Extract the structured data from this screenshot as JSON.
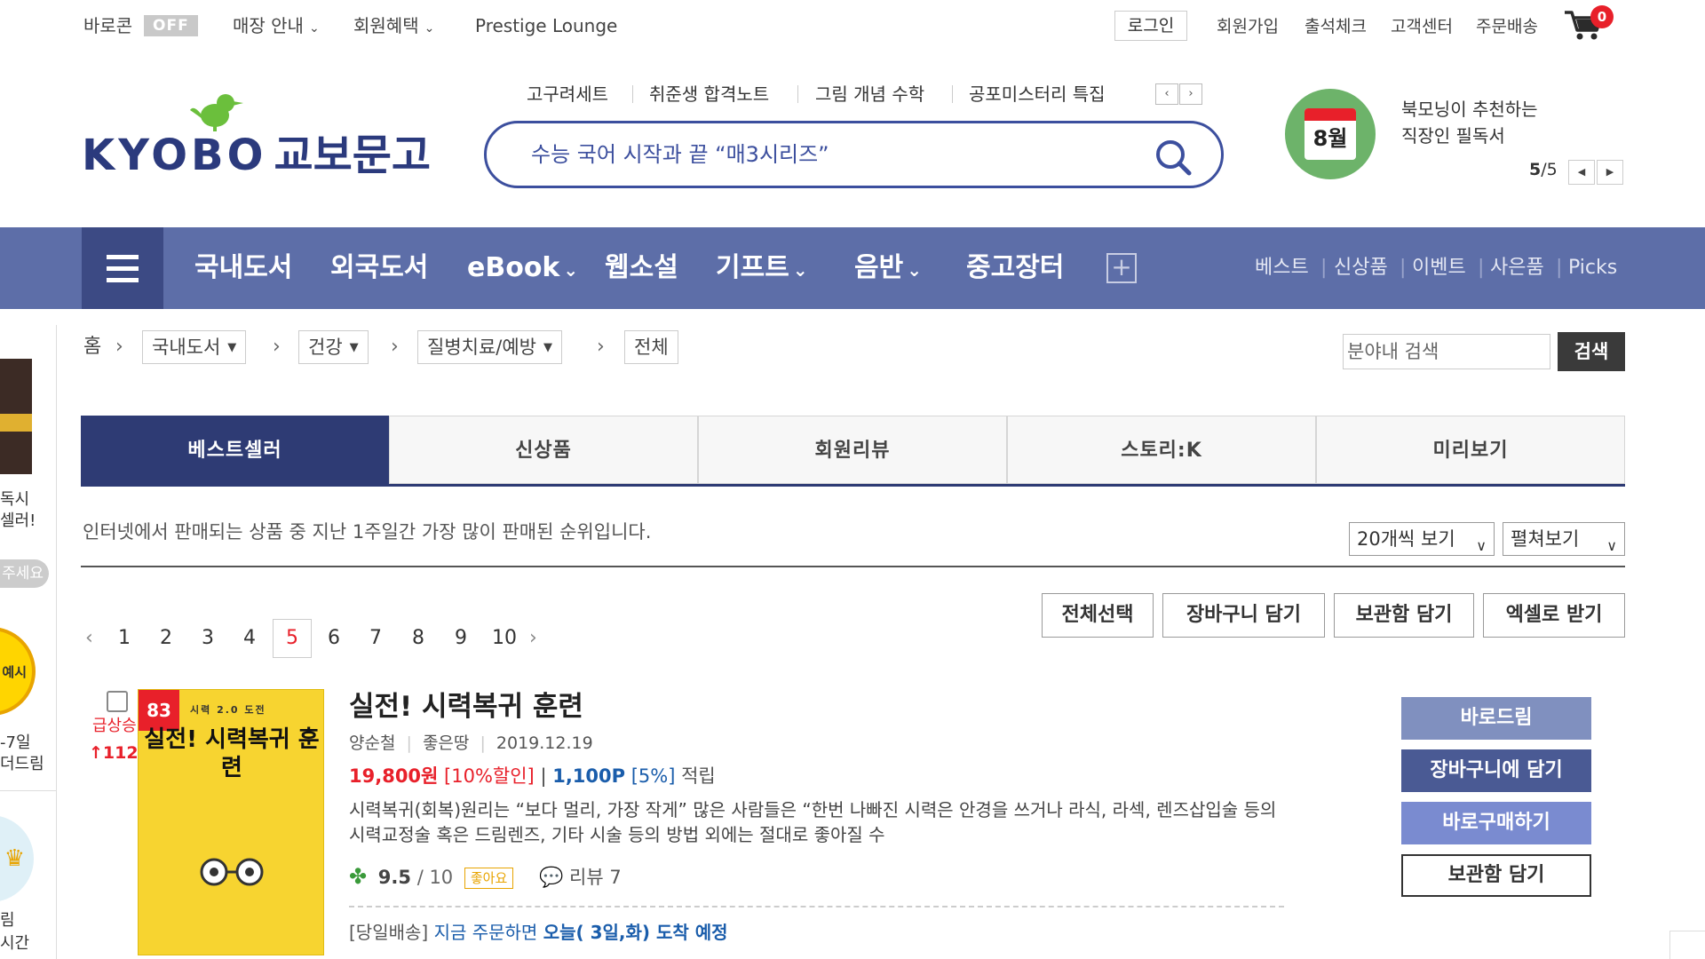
{
  "topbar": {
    "baroreturn": "바로콘",
    "off_badge": "OFF",
    "store_guide": "매장 안내",
    "member_benefit": "회원혜택",
    "prestige": "Prestige Lounge",
    "login": "로그인",
    "signup": "회원가입",
    "attendance": "출석체크",
    "customer_center": "고객센터",
    "order_delivery": "주문배송",
    "cart_count": "0"
  },
  "logo": {
    "latin": "KYOBO",
    "korean": "교보문고"
  },
  "keywords": {
    "items": [
      "고구려세트",
      "취준생 합격노트",
      "그림 개념 수학",
      "공포미스터리 특집"
    ],
    "prev": "‹",
    "next": "›"
  },
  "search": {
    "placeholder": "수능 국어 시작과 끝 “매3시리즈”"
  },
  "promo": {
    "month": "8월",
    "line1": "북모닝이 추천하는",
    "line2": "직장인 필독서",
    "count_current": "5",
    "count_sep": "/",
    "count_total": "5"
  },
  "nav": {
    "items": [
      "국내도서",
      "외국도서",
      "eBook",
      "웹소설",
      "기프트",
      "음반",
      "중고장터"
    ],
    "right": [
      "베스트",
      "신상품",
      "이벤트",
      "사은품",
      "Picks"
    ],
    "sep": "|"
  },
  "breadcrumb": {
    "home": "홈",
    "levels": [
      "국내도서",
      "건강",
      "질병치료/예방"
    ],
    "current": "전체",
    "search_placeholder": "분야내 검색",
    "search_button": "검색"
  },
  "tabs": [
    "베스트셀러",
    "신상품",
    "회원리뷰",
    "스토리:K",
    "미리보기"
  ],
  "description": "인터넷에서 판매되는 상품 중 지난 1주일간 가장 많이 판매된 순위입니다.",
  "view": {
    "count": "20개씩 보기",
    "mode": "펼쳐보기"
  },
  "actions": [
    "전체선택",
    "장바구니 담기",
    "보관함 담기",
    "엑셀로 받기"
  ],
  "pagination": {
    "pages": [
      "1",
      "2",
      "3",
      "4",
      "5",
      "6",
      "7",
      "8",
      "9",
      "10"
    ],
    "current": "5",
    "prev": "‹",
    "next": "›"
  },
  "product": {
    "rank": "83",
    "trend_label": "급상승",
    "trend_value": "↑112",
    "cover_subtitle": "시력 2.0 도전",
    "cover_title": "실전! 시력복귀 훈련",
    "title": "실전! 시력복귀 훈련",
    "author": "양순철",
    "publisher": "좋은땅",
    "date": "2019.12.19",
    "price": "19,800원",
    "discount": "[10%할인]",
    "points": "1,100P",
    "points_rate": "[5%]",
    "points_label": "적립",
    "description": "시력복귀(회복)원리는 “보다 멀리, 가장 작게” 많은 사람들은 “한번 나빠진 시력은 안경을 쓰거나 라식, 라섹, 렌즈삽입술 등의 시력교정술 혹은 드림렌즈, 기타 시술 등의 방법 외에는 절대로 좋아질 수",
    "rating": "9.5",
    "rating_max": "/ 10",
    "rating_badge": "좋아요",
    "review_label": "리뷰",
    "review_count": "7",
    "ship_prefix": "[당일배송]",
    "ship_text": "지금 주문하면",
    "ship_date": "오늘( 3일,화) 도착 예정"
  },
  "side_buttons": [
    "바로드림",
    "장바구니에 담기",
    "바로구매하기",
    "보관함 담기"
  ],
  "left_panel": {
    "texts": [
      "독시",
      "셀러!",
      "주세요",
      "예시",
      "-7일",
      "더드림",
      "림",
      "시간"
    ]
  },
  "colors": {
    "nav": "#5d6ea8",
    "nav_dark": "#3c4a84",
    "tab_active": "#2e3b74",
    "accent_red": "#e8202a",
    "blue": "#1a5dab",
    "btn_gray": "#8090bf",
    "btn_navy": "#4a5a94",
    "btn_lav": "#7a8bd0",
    "logo_green": "#6bbf3c"
  }
}
